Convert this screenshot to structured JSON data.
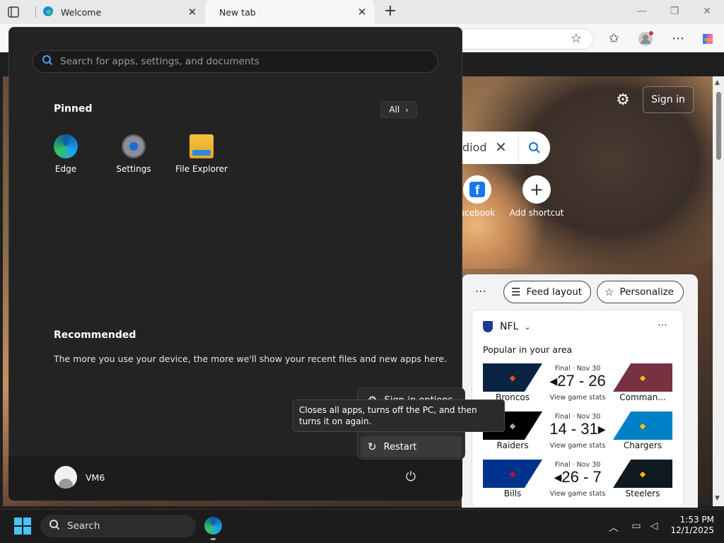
{
  "browser": {
    "tabs": [
      {
        "label": "Welcome"
      },
      {
        "label": "New tab"
      }
    ],
    "close_glyph": "✕",
    "new_tab_glyph": "+",
    "window_controls": [
      "—",
      "❐",
      "✕"
    ]
  },
  "ntp": {
    "sign_in_label": "Sign in",
    "search_query_fragment": "diod",
    "shortcuts": [
      {
        "label": "acebook",
        "icon": "facebook-icon"
      },
      {
        "label": "Add shortcut",
        "icon": "plus-icon"
      }
    ],
    "feed": {
      "feed_layout_label": "Feed layout",
      "personalize_label": "Personalize"
    },
    "nfl": {
      "title": "NFL",
      "subtitle": "Popular in your area",
      "games": [
        {
          "status": "Final · Nov 30",
          "score": "27 - 26",
          "winner": "left",
          "stats": "View game stats",
          "team_left": "Broncos",
          "team_right": "Comman...",
          "color_left": "#0a2343",
          "color_right": "#773141",
          "logo_left_color": "#fb4f14",
          "logo_right_color": "#ffb612"
        },
        {
          "status": "Final · Nov 30",
          "score": "14 - 31",
          "winner": "right",
          "stats": "View game stats",
          "team_left": "Raiders",
          "team_right": "Chargers",
          "color_left": "#000000",
          "color_right": "#0080c6",
          "logo_left_color": "#a5acaf",
          "logo_right_color": "#ffc20e"
        },
        {
          "status": "Final · Nov 30",
          "score": "26 - 7",
          "winner": "left",
          "stats": "View game stats",
          "team_left": "Bills",
          "team_right": "Steelers",
          "color_left": "#00338d",
          "color_right": "#101820",
          "logo_left_color": "#c60c30",
          "logo_right_color": "#ffb612"
        }
      ]
    }
  },
  "start_menu": {
    "search_placeholder": "Search for apps, settings, and documents",
    "pinned_title": "Pinned",
    "all_label": "All",
    "apps": [
      {
        "label": "Edge",
        "icon": "edge-icon"
      },
      {
        "label": "Settings",
        "icon": "settings-icon"
      },
      {
        "label": "File Explorer",
        "icon": "folder-icon"
      }
    ],
    "recommended_title": "Recommended",
    "recommended_text": "The more you use your device, the more we'll show your recent files and new apps here.",
    "user_name": "VM6",
    "power_menu": {
      "sign_in_options": "Sign-in options",
      "restart": "Restart",
      "tooltip": "Closes all apps, turns off the PC, and then turns it on again."
    }
  },
  "taskbar": {
    "search_label": "Search",
    "time": "1:53 PM",
    "date": "12/1/2025"
  },
  "colors": {
    "accent": "#4cc2ff",
    "start_bg": "#232323"
  }
}
